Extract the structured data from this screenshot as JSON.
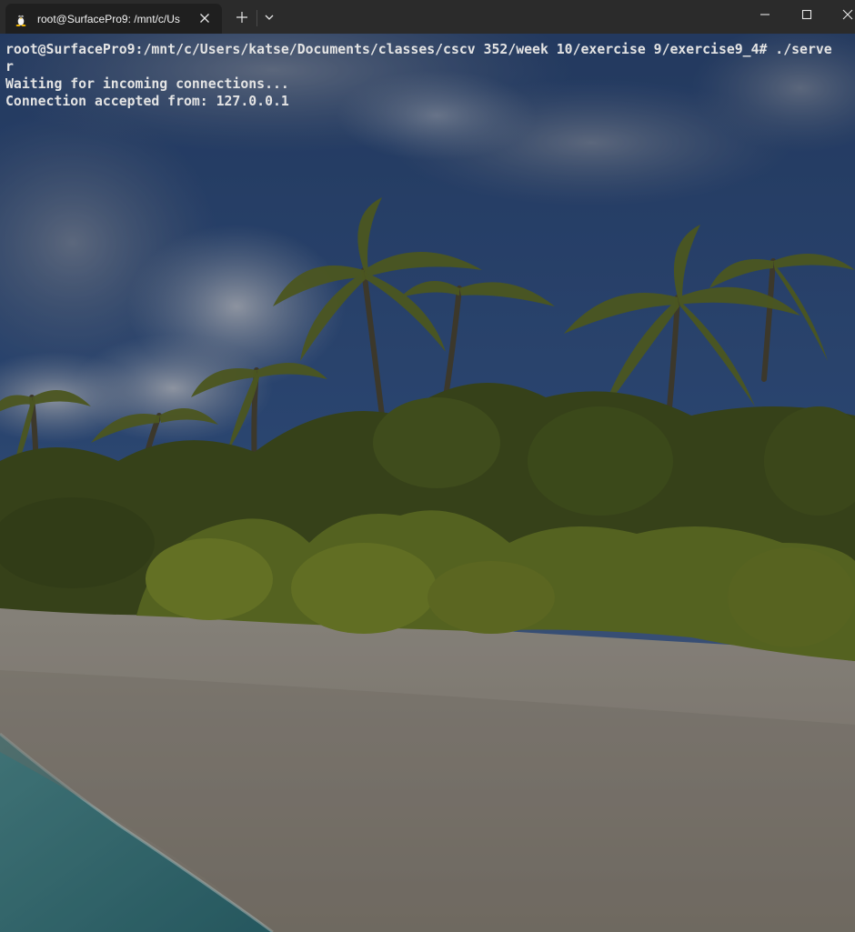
{
  "window": {
    "tab_title": "root@SurfacePro9: /mnt/c/Us",
    "tab_icon": "linux-penguin-icon",
    "new_tab_icon": "plus-icon",
    "dropdown_icon": "chevron-down-icon",
    "minimize_icon": "minimize-icon",
    "maximize_icon": "maximize-icon",
    "close_icon": "close-icon"
  },
  "terminal": {
    "lines": [
      "root@SurfacePro9:/mnt/c/Users/katse/Documents/classes/cscv 352/week 10/exercise 9/exercise9_4# ./serve",
      "r",
      "Waiting for incoming connections...",
      "Connection accepted from: 127.0.0.1"
    ],
    "text_color": "#e4e4e4",
    "background_image": "tropical beach with palm trees"
  },
  "colors": {
    "titlebar": "#2b2b2b",
    "active_tab": "#1f1f1f"
  }
}
